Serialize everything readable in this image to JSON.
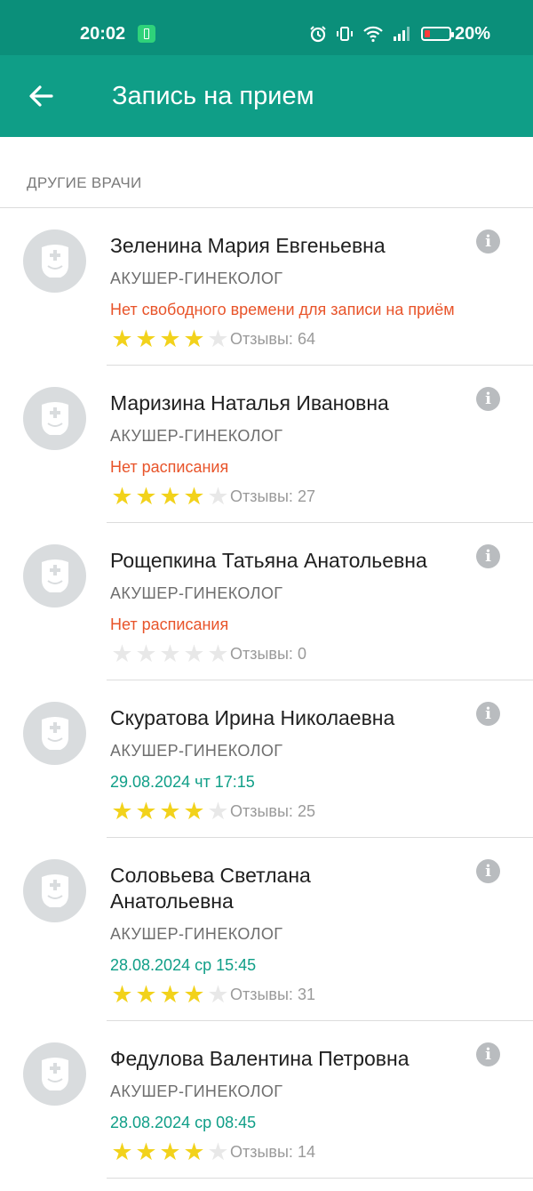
{
  "status_bar": {
    "time": "20:02",
    "battery_percent": "20%",
    "icons": [
      "sim-icon",
      "alarm-icon",
      "vibrate-icon",
      "wifi-icon",
      "signal-icon",
      "battery-icon"
    ]
  },
  "app_bar": {
    "title": "Запись на прием",
    "back_icon": "arrow-left-icon"
  },
  "section": {
    "header": "ДРУГИЕ ВРАЧИ"
  },
  "doctors": [
    {
      "name": "Зеленина Мария Евгеньевна",
      "specialty": "АКУШЕР-ГИНЕКОЛОГ",
      "status": "Нет свободного времени для записи на приём",
      "status_type": "warning",
      "rating": 4,
      "reviews": "Отзывы: 64"
    },
    {
      "name": "Маризина Наталья Ивановна",
      "specialty": "АКУШЕР-ГИНЕКОЛОГ",
      "status": "Нет расписания",
      "status_type": "warning",
      "rating": 4,
      "reviews": "Отзывы: 27"
    },
    {
      "name": "Рощепкина Татьяна Анатольевна",
      "specialty": "АКУШЕР-ГИНЕКОЛОГ",
      "status": "Нет расписания",
      "status_type": "warning",
      "rating": 0,
      "reviews": "Отзывы: 0"
    },
    {
      "name": "Скуратова Ирина Николаевна",
      "specialty": "АКУШЕР-ГИНЕКОЛОГ",
      "status": "29.08.2024 чт 17:15",
      "status_type": "slot",
      "rating": 4,
      "reviews": "Отзывы: 25"
    },
    {
      "name": "Соловьева Светлана Анатольевна",
      "specialty": "АКУШЕР-ГИНЕКОЛОГ",
      "status": "28.08.2024 ср 15:45",
      "status_type": "slot",
      "rating": 4,
      "reviews": "Отзывы: 31"
    },
    {
      "name": "Федулова Валентина Петровна",
      "specialty": "АКУШЕР-ГИНЕКОЛОГ",
      "status": "28.08.2024 ср 08:45",
      "status_type": "slot",
      "rating": 4,
      "reviews": "Отзывы: 14"
    }
  ],
  "colors": {
    "status_bar": "#0b8f7a",
    "app_bar": "#0f9e87",
    "warning": "#e8542a",
    "slot": "#0f9e87",
    "star_on": "#f2d21b",
    "star_off": "#e8e8e8"
  }
}
